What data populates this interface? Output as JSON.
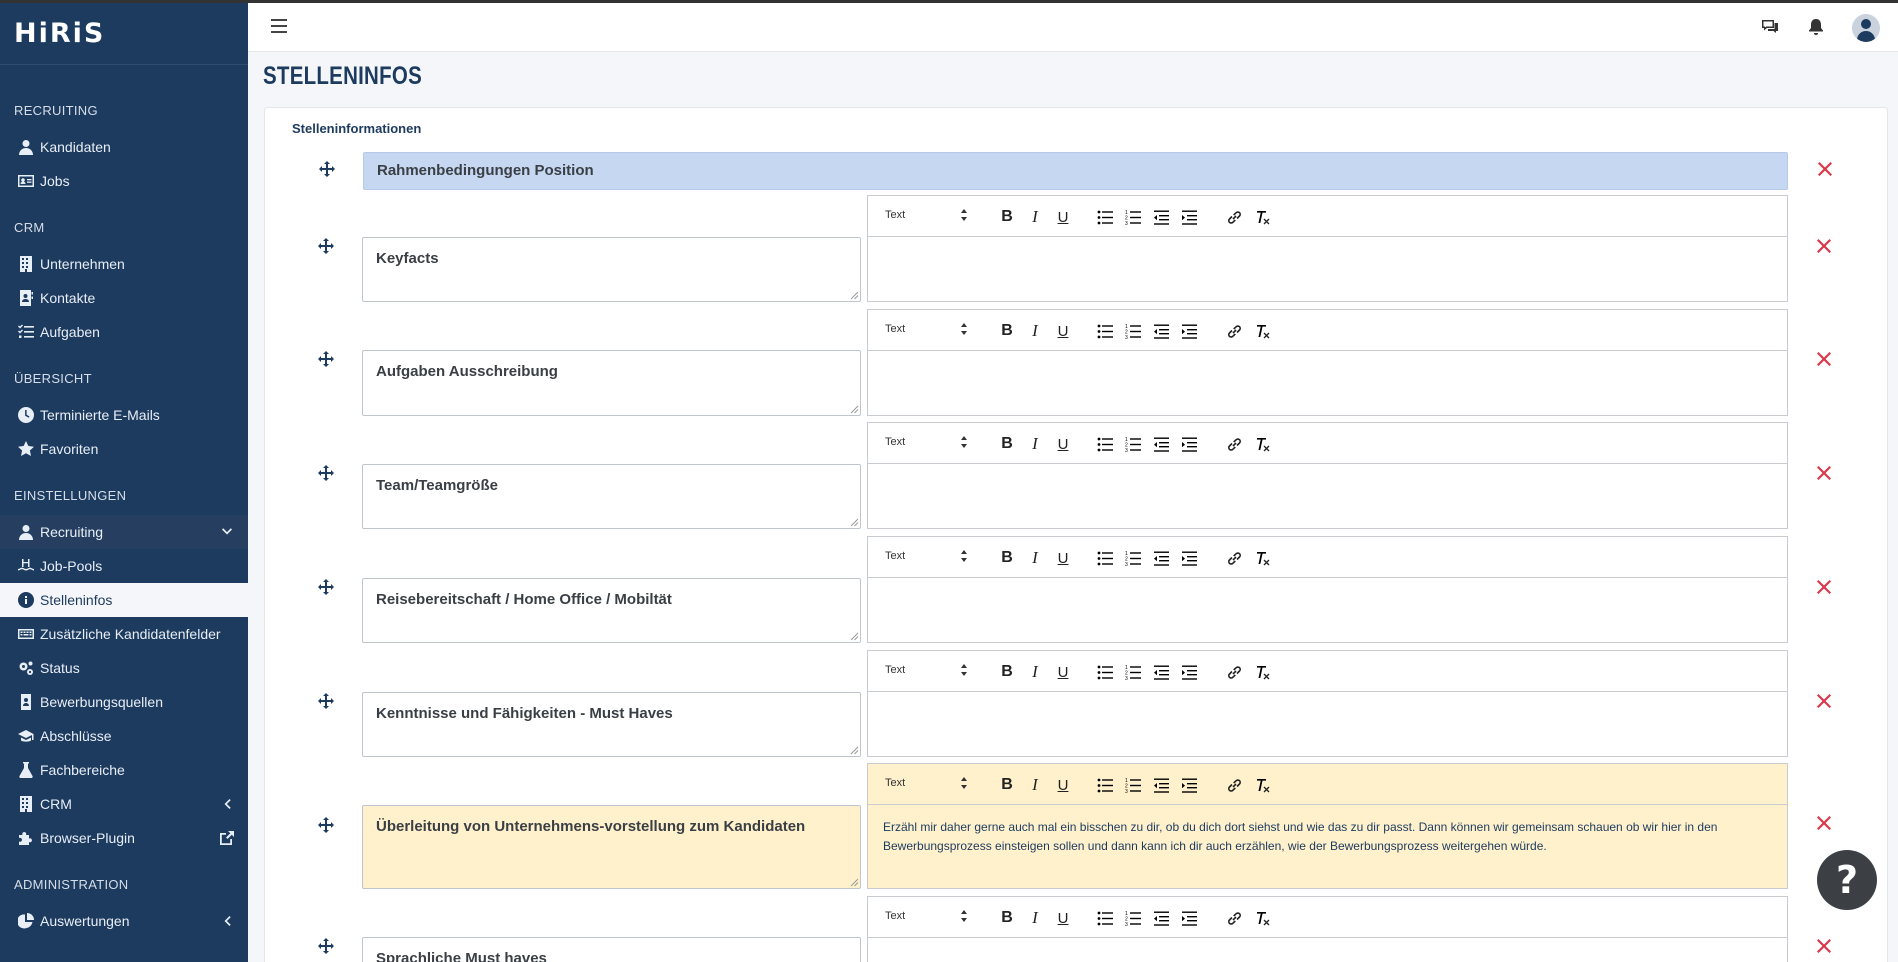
{
  "app": {
    "logo": "HiRiS"
  },
  "topbar": {
    "menu_icon": "hamburger-icon",
    "icons": [
      "chat-icon",
      "bell-icon",
      "user-avatar"
    ]
  },
  "sidebar": {
    "sections": [
      {
        "title": "RECRUITING",
        "items": [
          {
            "label": "Kandidaten",
            "icon": "user-icon"
          },
          {
            "label": "Jobs",
            "icon": "id-card-icon"
          }
        ]
      },
      {
        "title": "CRM",
        "items": [
          {
            "label": "Unternehmen",
            "icon": "building-icon"
          },
          {
            "label": "Kontakte",
            "icon": "contact-book-icon"
          },
          {
            "label": "Aufgaben",
            "icon": "task-list-icon"
          }
        ]
      },
      {
        "title": "ÜBERSICHT",
        "items": [
          {
            "label": "Terminierte E-Mails",
            "icon": "clock-icon"
          },
          {
            "label": "Favoriten",
            "icon": "star-icon"
          }
        ]
      },
      {
        "title": "EINSTELLUNGEN",
        "items": [
          {
            "label": "Recruiting",
            "icon": "user-icon"
          },
          {
            "label": "Job-Pools",
            "icon": "pool-icon"
          },
          {
            "label": "Stelleninfos",
            "icon": "info-icon"
          },
          {
            "label": "Zusätzliche Kandidatenfelder",
            "icon": "keyboard-icon"
          },
          {
            "label": "Status",
            "icon": "gears-icon"
          },
          {
            "label": "Bewerbungsquellen",
            "icon": "badge-icon"
          },
          {
            "label": "Abschlüsse",
            "icon": "graduation-cap-icon"
          },
          {
            "label": "Fachbereiche",
            "icon": "flask-icon"
          },
          {
            "label": "CRM",
            "icon": "building-icon"
          },
          {
            "label": "Browser-Plugin",
            "icon": "puzzle-icon"
          }
        ]
      },
      {
        "title": "ADMINISTRATION",
        "items": [
          {
            "label": "Auswertungen",
            "icon": "pie-chart-icon"
          }
        ]
      }
    ]
  },
  "page": {
    "title": "STELLENINFOS",
    "card_title": "Stelleninformationen",
    "header_row": "Rahmenbedingungen Position",
    "rows": [
      {
        "label": "Keyfacts",
        "content": ""
      },
      {
        "label": "Aufgaben Ausschreibung",
        "content": ""
      },
      {
        "label": "Team/Teamgröße",
        "content": ""
      },
      {
        "label": "Reisebereitschaft / Home Office / Mobiltät",
        "content": ""
      },
      {
        "label": "Kenntnisse und Fähigkeiten - Must Haves",
        "content": ""
      },
      {
        "label": "Überleitung von Unternehmens-vorstellung zum Kandidaten",
        "content": "Erzähl mir daher gerne auch mal ein bisschen zu dir, ob du dich dort siehst und wie das zu dir passt. Dann können wir gemeinsam schauen ob wir hier in den Bewerbungsprozess einsteigen sollen und dann kann ich dir auch erzählen, wie der Bewerbungsprozess weitergehen würde.",
        "highlighted": true
      },
      {
        "label": "Sprachliche Must haves",
        "content": ""
      }
    ],
    "editor_format": "Text",
    "toolbar_buttons": [
      "bold-icon",
      "italic-icon",
      "underline-icon",
      "bullet-list-icon",
      "numbered-list-icon",
      "outdent-icon",
      "indent-icon",
      "link-icon",
      "clear-format-icon"
    ]
  },
  "help_button": "?"
}
